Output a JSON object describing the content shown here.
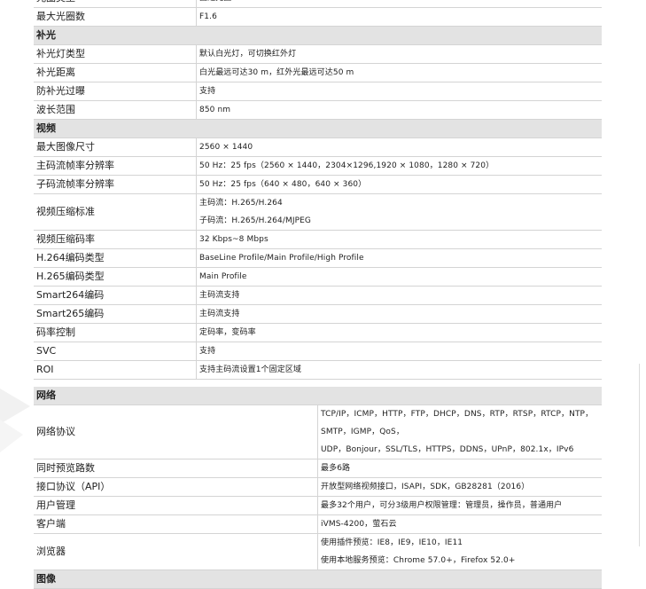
{
  "sections_a": [
    {
      "type": "row",
      "key": "光圈类型",
      "values": [
        "固定光圈"
      ]
    },
    {
      "type": "row",
      "key": "最大光圈数",
      "values": [
        "F1.6"
      ]
    },
    {
      "type": "section",
      "title": "补光"
    },
    {
      "type": "row",
      "key": "补光灯类型",
      "values": [
        "默认白光灯，可切换红外灯"
      ]
    },
    {
      "type": "row",
      "key": "补光距离",
      "values": [
        "白光最远可达30 m，红外光最远可达50 m"
      ]
    },
    {
      "type": "row",
      "key": "防补光过曝",
      "values": [
        "支持"
      ]
    },
    {
      "type": "row",
      "key": "波长范围",
      "values": [
        "850 nm"
      ]
    },
    {
      "type": "section",
      "title": "视频"
    },
    {
      "type": "row",
      "key": "最大图像尺寸",
      "values": [
        "2560 × 1440"
      ]
    },
    {
      "type": "row",
      "key": "主码流帧率分辨率",
      "values": [
        "50 Hz：25 fps（2560 × 1440，2304×1296,1920 × 1080，1280 × 720）"
      ]
    },
    {
      "type": "row",
      "key": "子码流帧率分辨率",
      "values": [
        "50 Hz：25 fps（640 × 480，640 × 360）"
      ]
    },
    {
      "type": "row",
      "key": "视频压缩标准",
      "values": [
        "主码流：H.265/H.264",
        "子码流：H.265/H.264/MJPEG"
      ]
    },
    {
      "type": "row",
      "key": "视频压缩码率",
      "values": [
        "32 Kbps~8 Mbps"
      ]
    },
    {
      "type": "row",
      "key": "H.264编码类型",
      "values": [
        "BaseLine Profile/Main Profile/High Profile"
      ]
    },
    {
      "type": "row",
      "key": "H.265编码类型",
      "values": [
        "Main Profile"
      ]
    },
    {
      "type": "row",
      "key": "Smart264编码",
      "values": [
        "主码流支持"
      ]
    },
    {
      "type": "row",
      "key": "Smart265编码",
      "values": [
        "主码流支持"
      ]
    },
    {
      "type": "row",
      "key": "码率控制",
      "values": [
        "定码率，变码率"
      ]
    },
    {
      "type": "row",
      "key": "SVC",
      "values": [
        "支持"
      ]
    },
    {
      "type": "row",
      "key": "ROI",
      "values": [
        "支持主码流设置1个固定区域"
      ]
    }
  ],
  "sections_b": [
    {
      "type": "section",
      "title": "网络"
    },
    {
      "type": "row",
      "key": "网络协议",
      "values": [
        "TCP/IP，ICMP，HTTP，FTP，DHCP，DNS，RTP，RTSP，RTCP，NTP，SMTP，IGMP，QoS，",
        "UDP，Bonjour，SSL/TLS，HTTPS，DDNS，UPnP，802.1x，IPv6"
      ]
    },
    {
      "type": "row",
      "key": "同时预览路数",
      "values": [
        "最多6路"
      ]
    },
    {
      "type": "row",
      "key": "接口协议（API）",
      "values": [
        "开放型网络视频接口，ISAPI，SDK，GB28281（2016）"
      ]
    },
    {
      "type": "row",
      "key": "用户管理",
      "values": [
        "最多32个用户，可分3级用户权限管理：管理员，操作员，普通用户"
      ]
    },
    {
      "type": "row",
      "key": "客户端",
      "values": [
        "iVMS-4200，萤石云"
      ]
    },
    {
      "type": "row",
      "key": "浏览器",
      "values": [
        "使用插件预览：IE8，IE9，IE10，IE11",
        "使用本地服务预览：Chrome 57.0+，Firefox 52.0+"
      ]
    },
    {
      "type": "section",
      "title": "图像"
    }
  ]
}
